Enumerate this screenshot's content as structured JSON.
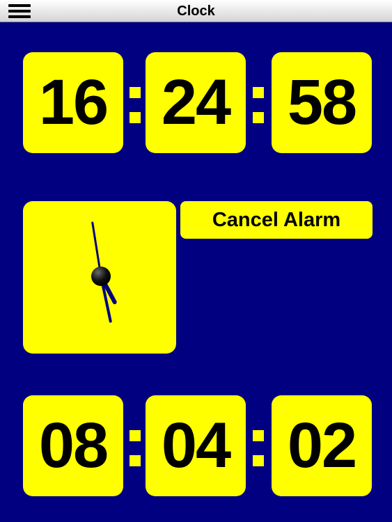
{
  "window": {
    "title": "Clock",
    "menu_icon": "hamburger-menu-icon"
  },
  "current_time": {
    "hours": "16",
    "minutes": "24",
    "seconds": "58"
  },
  "analog_clock": {
    "hour_hand_angle_deg": 152,
    "minute_hand_angle_deg": 168,
    "second_hand_angle_deg": -9,
    "colors": {
      "face": "#ffff00",
      "hands": "#000080",
      "hub": "#000000"
    }
  },
  "alarm": {
    "cancel_label": "Cancel Alarm"
  },
  "countdown": {
    "hours": "08",
    "minutes": "04",
    "seconds": "02"
  },
  "colors": {
    "background": "#000080",
    "tile": "#ffff00",
    "text": "#000000"
  }
}
